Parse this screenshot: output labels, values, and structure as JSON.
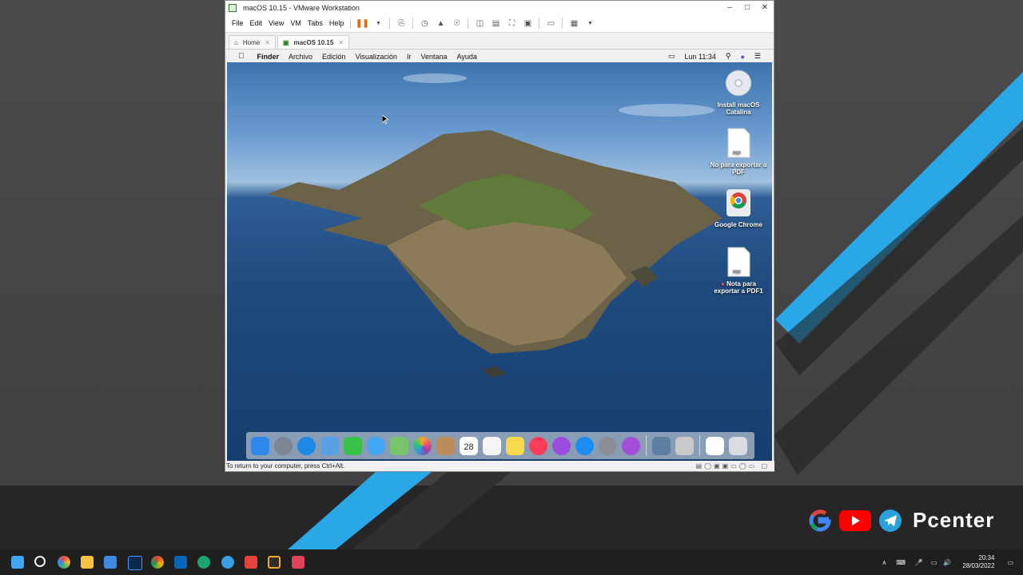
{
  "window": {
    "title": "macOS 10.15 - VMware Workstation",
    "menu": [
      "File",
      "Edit",
      "View",
      "VM",
      "Tabs",
      "Help"
    ],
    "tabs": [
      {
        "label": "Home"
      },
      {
        "label": "macOS 10.15"
      }
    ],
    "status_text": "To return to your computer, press Ctrl+Alt."
  },
  "mac": {
    "menubar": {
      "app": "Finder",
      "items": [
        "Archivo",
        "Edición",
        "Visualización",
        "Ir",
        "Ventana",
        "Ayuda"
      ],
      "clock": "Lun 11:34"
    },
    "desktop_icons": [
      {
        "label": "Install macOS Catalina",
        "icon": "dvd-icon"
      },
      {
        "label": "No para exportar a PDF",
        "icon": "pdf-file-icon"
      },
      {
        "label": "Google Chrome",
        "icon": "chrome-icon"
      },
      {
        "label": "Nota para exportar a PDF1",
        "icon": "pdf-file-icon"
      }
    ],
    "dock_apps": [
      {
        "icon": "finder-icon",
        "color": "#2f88ea"
      },
      {
        "icon": "launchpad-icon",
        "color": "#7b8794"
      },
      {
        "icon": "safari-icon",
        "color": "#1e88e5"
      },
      {
        "icon": "mail-icon",
        "color": "#5aa0e6"
      },
      {
        "icon": "facetime-icon",
        "color": "#37c24a"
      },
      {
        "icon": "messages-icon",
        "color": "#3fa7f5"
      },
      {
        "icon": "maps-icon",
        "color": "#76c46b"
      },
      {
        "icon": "photos-icon",
        "color": "#f1b33c"
      },
      {
        "icon": "contacts-icon",
        "color": "#b98d5c"
      },
      {
        "icon": "calendar-icon",
        "color": "#ffffff"
      },
      {
        "icon": "reminders-icon",
        "color": "#f5f5f5"
      },
      {
        "icon": "notes-icon",
        "color": "#f7d94c"
      },
      {
        "icon": "music-icon",
        "color": "#fb3c5a"
      },
      {
        "icon": "podcasts-icon",
        "color": "#9b4de0"
      },
      {
        "icon": "app-store-icon",
        "color": "#1a8cf2"
      },
      {
        "icon": "system-preferences-icon",
        "color": "#8a8f96"
      },
      {
        "icon": "feedback-icon",
        "color": "#a14ed8"
      },
      {
        "icon": "preview-icon",
        "color": "#5f7fa2"
      },
      {
        "icon": "printer-icon",
        "color": "#c9c9c9"
      },
      {
        "icon": "document-icon",
        "color": "#ffffff"
      },
      {
        "icon": "trash-icon",
        "color": "#d8dde2"
      }
    ],
    "calendar_day": "28"
  },
  "brand": {
    "name": "Pcenter"
  },
  "taskbar": {
    "time": "20:34",
    "date": "28/03/2022"
  }
}
